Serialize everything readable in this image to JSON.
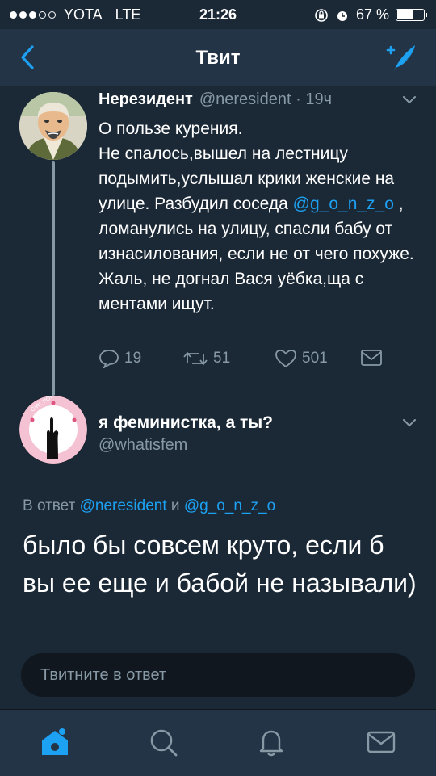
{
  "status_bar": {
    "carrier": "YOTA",
    "network": "LTE",
    "time": "21:26",
    "battery": "67 %",
    "battery_level": 0.67
  },
  "nav": {
    "title": "Твит",
    "back_icon": "chevron-left-icon",
    "compose_icon": "compose-tweet-icon"
  },
  "tweet1": {
    "name": "Нерезидент",
    "handle": "@neresident",
    "time": "· 19ч",
    "text_parts": [
      "О пользе курения.\nНе спалось,вышел на лестницу подымить,услышал крики женские на улице. Разбудил соседа ",
      "@g_o_n_z_o",
      " , ломанулись на улицу, спасли бабу от изнасилования, если не от чего похуже. Жаль, не догнал Вася уёбка,ща с ментами ищут."
    ],
    "replies": "19",
    "retweets": "51",
    "likes": "501"
  },
  "tweet2": {
    "name": "я феминистка, а ты?",
    "handle": "@whatisfem",
    "avatar_badge": "GIRL POWER",
    "reply_prefix": "В ответ",
    "reply_mention1": "@neresident",
    "reply_and": "и",
    "reply_mention2": "@g_o_n_z_o",
    "text": "было бы совсем круто, если б вы ее еще и бабой не называли)"
  },
  "reply_box": {
    "placeholder": "Твитните в ответ"
  },
  "colors": {
    "background": "#1b2836",
    "bar": "#243447",
    "accent": "#1da1f2",
    "muted": "#8899a6"
  }
}
